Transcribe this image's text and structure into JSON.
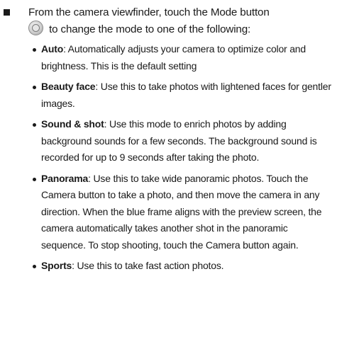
{
  "instruction": {
    "text_before_icon": "From the camera viewfinder, touch the Mode button",
    "icon": "mode-button-icon",
    "text_after_icon": "to change the mode to one of the following:"
  },
  "modes": [
    {
      "term": "Auto",
      "description": ": Automatically adjusts your camera to optimize color and brightness. This is the default setting"
    },
    {
      "term": "Beauty face",
      "description": ": Use this to take photos with lightened faces for gentler images."
    },
    {
      "term": "Sound & shot",
      "description": ": Use this mode to enrich photos by adding background sounds for a few seconds. The background sound is recorded for up to 9 seconds after taking the photo."
    },
    {
      "term": "Panorama",
      "description": ": Use this to take wide panoramic photos. Touch the Camera button to take a photo, and then move the camera in any direction. When the blue frame aligns with the preview screen, the camera automatically takes another shot in the panoramic sequence. To stop shooting, touch the Camera button again."
    },
    {
      "term": "Sports",
      "description": ": Use this to take fast action photos."
    }
  ]
}
